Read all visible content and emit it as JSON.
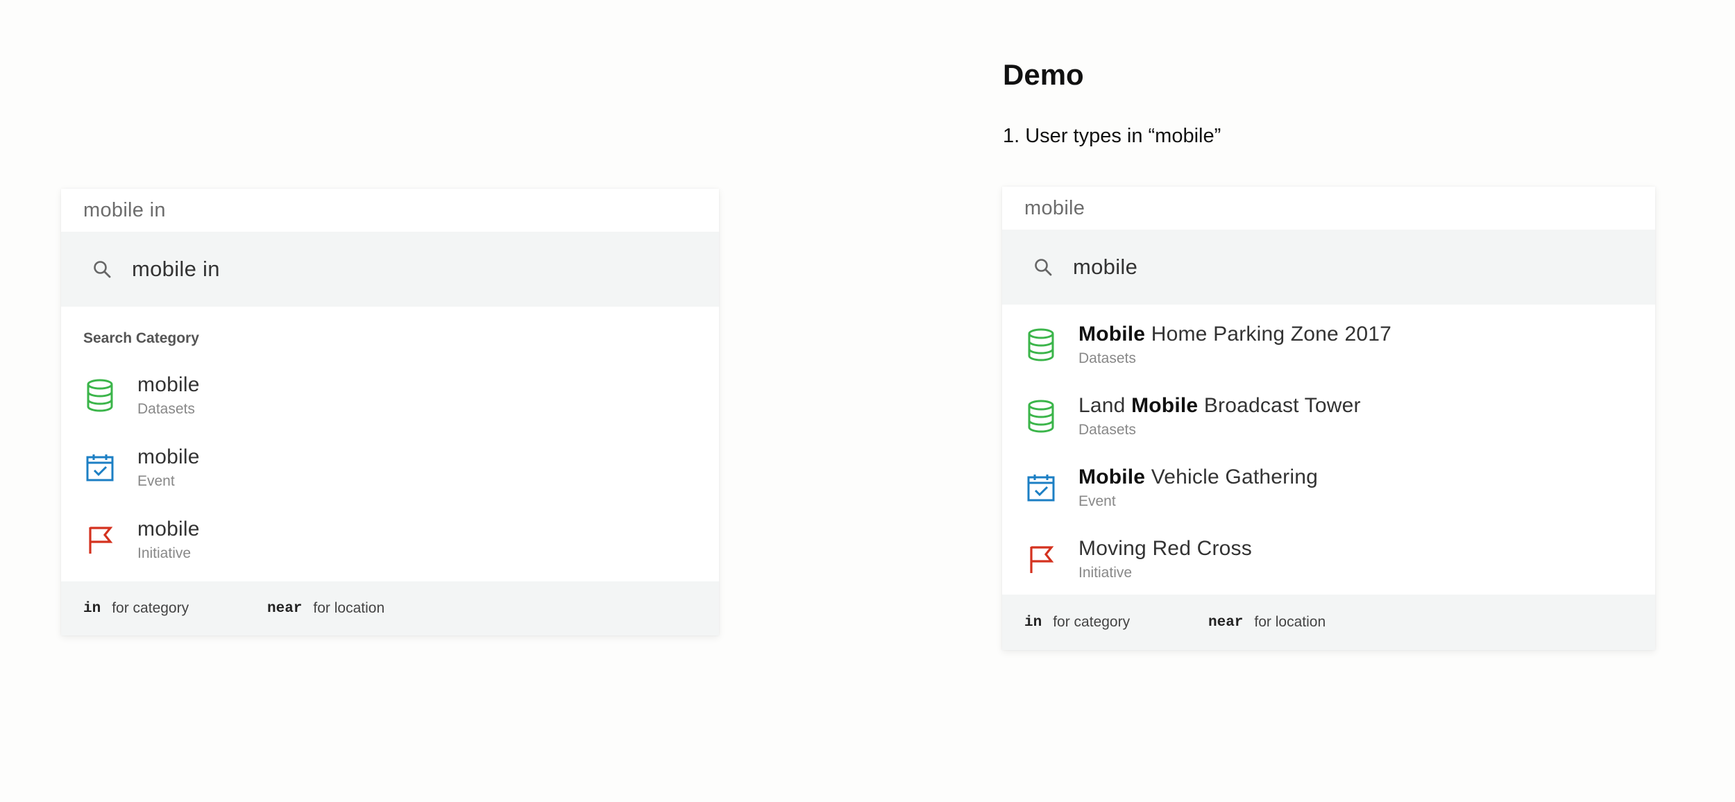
{
  "demo": {
    "title": "Demo",
    "step": "1. User types in “mobile”"
  },
  "left_panel": {
    "input_value": "mobile in",
    "search_query": "mobile in",
    "section_label": "Search Category",
    "results": [
      {
        "title": "mobile",
        "category": "Datasets",
        "icon": "database-icon"
      },
      {
        "title": "mobile",
        "category": "Event",
        "icon": "calendar-check-icon"
      },
      {
        "title": "mobile",
        "category": "Initiative",
        "icon": "flag-icon"
      }
    ],
    "footer": {
      "in_key": "in",
      "in_label": "for category",
      "near_key": "near",
      "near_label": "for location"
    }
  },
  "right_panel": {
    "input_value": "mobile",
    "search_query": "mobile",
    "results": [
      {
        "pre": "",
        "match": "Mobile",
        "post": " Home Parking Zone 2017",
        "category": "Datasets",
        "icon": "database-icon"
      },
      {
        "pre": "Land ",
        "match": "Mobile",
        "post": " Broadcast Tower",
        "category": "Datasets",
        "icon": "database-icon"
      },
      {
        "pre": "",
        "match": "Mobile",
        "post": " Vehicle Gathering",
        "category": "Event",
        "icon": "calendar-check-icon"
      },
      {
        "pre": "Moving Red Cross",
        "match": "",
        "post": "",
        "category": "Initiative",
        "icon": "flag-icon"
      }
    ],
    "footer": {
      "in_key": "in",
      "in_label": "for category",
      "near_key": "near",
      "near_label": "for location"
    }
  },
  "colors": {
    "dataset_green": "#3bb54a",
    "event_blue": "#1c7fc4",
    "initiative_red": "#d4321f",
    "search_bar_bg": "#f3f5f5"
  }
}
